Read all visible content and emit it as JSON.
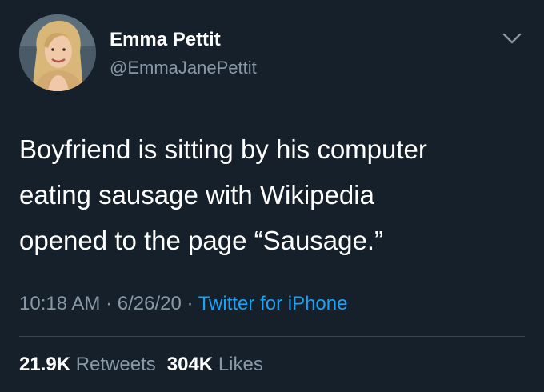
{
  "user": {
    "display_name": "Emma Pettit",
    "handle": "@EmmaJanePettit",
    "avatar_icon": "profile-photo"
  },
  "menu_icon": "chevron-down-icon",
  "tweet": {
    "lines": [
      "Boyfriend is sitting by his computer",
      "eating sausage with Wikipedia",
      "opened to the page “Sausage.”"
    ]
  },
  "meta": {
    "time": "10:18 AM",
    "sep1": " · ",
    "date": "6/26/20",
    "sep2": " · ",
    "source": "Twitter for iPhone"
  },
  "stats": {
    "retweets_count": "21.9K",
    "retweets_label": "Retweets",
    "likes_count": "304K",
    "likes_label": "Likes"
  },
  "colors": {
    "background": "#15202b",
    "text_primary": "#ffffff",
    "text_secondary": "#8899a6",
    "link": "#1da1f2",
    "divider": "#38444d"
  }
}
